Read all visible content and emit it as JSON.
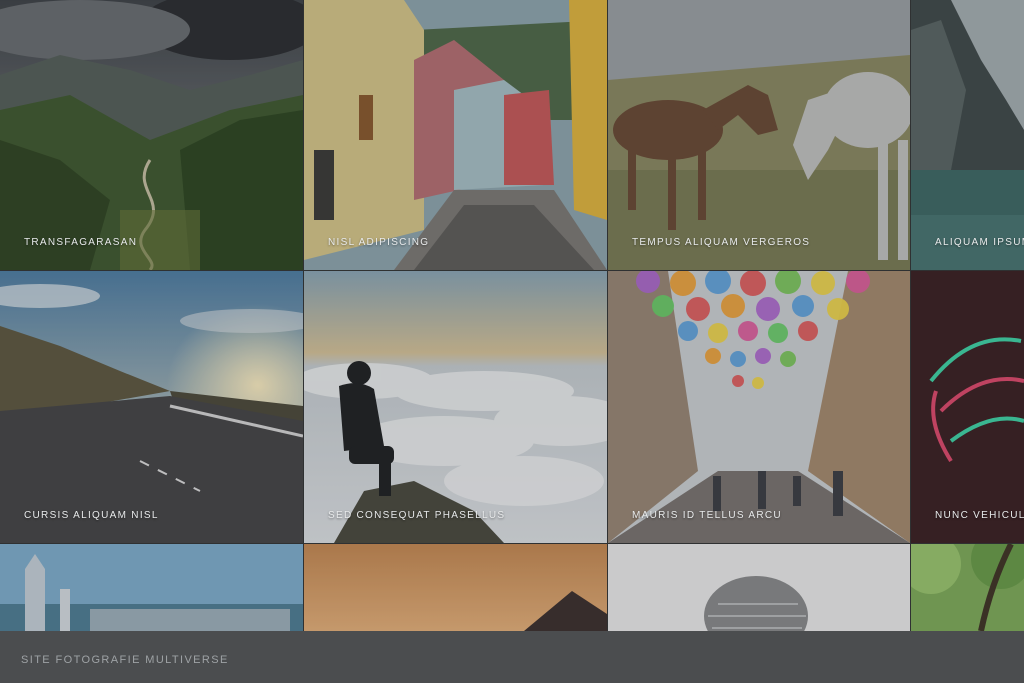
{
  "footer": {
    "site_title": "Site Fotografie Multiverse"
  },
  "gallery": {
    "items": [
      {
        "caption": "Transfagarasan",
        "subject": "mountain valley with winding road"
      },
      {
        "caption": "Nisl adipiscing",
        "subject": "cobblestone street with colorful houses"
      },
      {
        "caption": "Tempus aliquam vergeros",
        "subject": "two horses on a grassy field"
      },
      {
        "caption": "Aliquam ipsum",
        "subject": "cliff over a lake"
      },
      {
        "caption": "Cursis aliquam nisl",
        "subject": "mountain road at sunset"
      },
      {
        "caption": "Sed consequat phasellus",
        "subject": "person sitting above a sea of clouds"
      },
      {
        "caption": "Mauris id tellus arcu",
        "subject": "street decorated with floating umbrellas"
      },
      {
        "caption": "Nunc vehicula",
        "subject": "glowing hand in the dark"
      },
      {
        "caption": "",
        "subject": "city skyline"
      },
      {
        "caption": "",
        "subject": "mountain silhouette at dusk"
      },
      {
        "caption": "",
        "subject": "knit beanie hat"
      },
      {
        "caption": "",
        "subject": "green forest canopy"
      }
    ]
  }
}
